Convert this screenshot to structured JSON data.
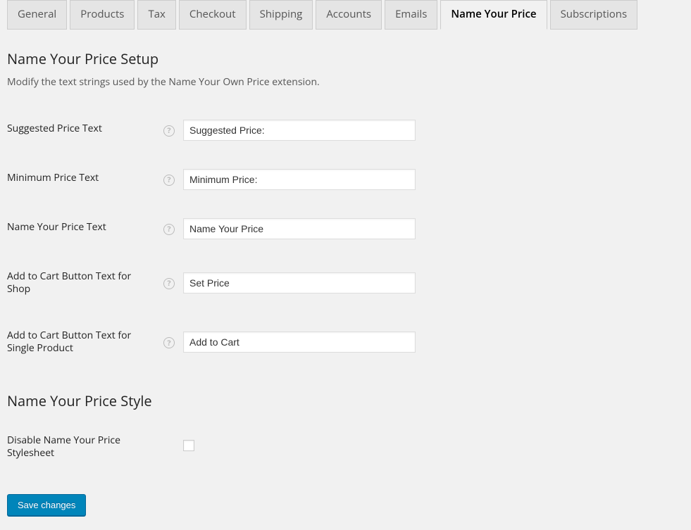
{
  "tabs": [
    {
      "label": "General"
    },
    {
      "label": "Products"
    },
    {
      "label": "Tax"
    },
    {
      "label": "Checkout"
    },
    {
      "label": "Shipping"
    },
    {
      "label": "Accounts"
    },
    {
      "label": "Emails"
    },
    {
      "label": "Name Your Price"
    },
    {
      "label": "Subscriptions"
    }
  ],
  "section1": {
    "title": "Name Your Price Setup",
    "desc": "Modify the text strings used by the Name Your Own Price extension."
  },
  "fields": {
    "suggested": {
      "label": "Suggested Price Text",
      "value": "Suggested Price:"
    },
    "minimum": {
      "label": "Minimum Price Text",
      "value": "Minimum Price:"
    },
    "nyp": {
      "label": "Name Your Price Text",
      "value": "Name Your Price"
    },
    "addtocart_shop": {
      "label": "Add to Cart Button Text for Shop",
      "value": "Set Price"
    },
    "addtocart_single": {
      "label": "Add to Cart Button Text for Single Product",
      "value": "Add to Cart"
    }
  },
  "section2": {
    "title": "Name Your Price Style"
  },
  "fields2": {
    "disable_css": {
      "label": "Disable Name Your Price Stylesheet"
    }
  },
  "submit": {
    "label": "Save changes"
  },
  "help_glyph": "?"
}
